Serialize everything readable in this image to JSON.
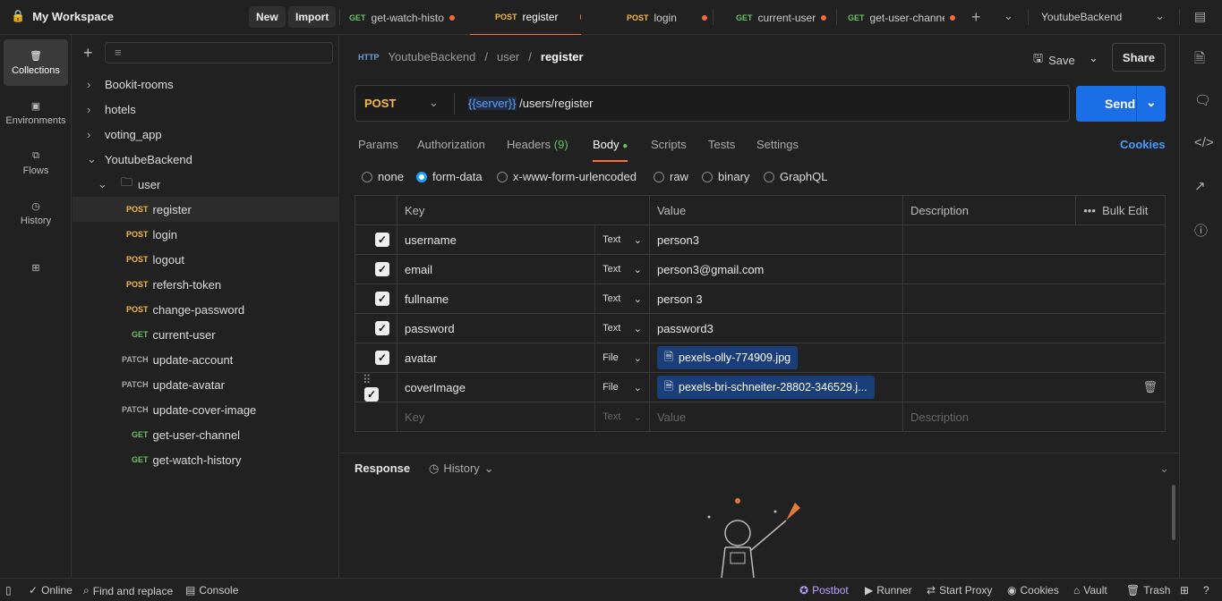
{
  "topbar": {
    "workspace": "My Workspace",
    "new_label": "New",
    "import_label": "Import",
    "tabs": [
      {
        "method": "GET",
        "name": "get-watch-histo"
      },
      {
        "method": "POST",
        "name": "register"
      },
      {
        "method": "POST",
        "name": "login"
      },
      {
        "method": "GET",
        "name": "current-user"
      },
      {
        "method": "GET",
        "name": "get-user-channe"
      }
    ],
    "environment": "YoutubeBackend"
  },
  "leftnav": [
    {
      "label": "Collections",
      "icon": "collections-icon"
    },
    {
      "label": "Environments",
      "icon": "environments-icon"
    },
    {
      "label": "Flows",
      "icon": "flows-icon"
    },
    {
      "label": "History",
      "icon": "history-icon"
    }
  ],
  "sidebar": {
    "collections": [
      "Bookit-rooms",
      "hotels",
      "voting_app",
      "YoutubeBackend"
    ],
    "folder": "user",
    "requests": [
      {
        "method": "POST",
        "name": "register"
      },
      {
        "method": "POST",
        "name": "login"
      },
      {
        "method": "POST",
        "name": "logout"
      },
      {
        "method": "POST",
        "name": "refersh-token"
      },
      {
        "method": "POST",
        "name": "change-password"
      },
      {
        "method": "GET",
        "name": "current-user"
      },
      {
        "method": "PATCH",
        "name": "update-account"
      },
      {
        "method": "PATCH",
        "name": "update-avatar"
      },
      {
        "method": "PATCH",
        "name": "update-cover-image"
      },
      {
        "method": "GET",
        "name": "get-user-channel"
      },
      {
        "method": "GET",
        "name": "get-watch-history"
      }
    ]
  },
  "request": {
    "breadcrumb": [
      "YoutubeBackend",
      "user",
      "register"
    ],
    "save_label": "Save",
    "share_label": "Share",
    "method": "POST",
    "url_var": "{{server}}",
    "url_path": " /users/register",
    "send_label": "Send",
    "tabs": [
      "Params",
      "Authorization",
      "Headers",
      "Body",
      "Scripts",
      "Tests",
      "Settings"
    ],
    "headers_count": "(9)",
    "cookies_label": "Cookies",
    "body_types": [
      "none",
      "form-data",
      "x-www-form-urlencoded",
      "raw",
      "binary",
      "GraphQL"
    ],
    "columns": [
      "Key",
      "Value",
      "Description"
    ],
    "bulk_edit": "Bulk Edit",
    "rows": [
      {
        "key": "username",
        "type": "Text",
        "value": "person3"
      },
      {
        "key": "email",
        "type": "Text",
        "value": "person3@gmail.com"
      },
      {
        "key": "fullname",
        "type": "Text",
        "value": "person 3"
      },
      {
        "key": "password",
        "type": "Text",
        "value": "password3"
      },
      {
        "key": "avatar",
        "type": "File",
        "value": "pexels-olly-774909.jpg"
      },
      {
        "key": "coverImage",
        "type": "File",
        "value": "pexels-bri-schneiter-28802-346529.j..."
      }
    ],
    "placeholder": {
      "key": "Key",
      "type": "Text",
      "value": "Value",
      "description": "Description"
    }
  },
  "response": {
    "label": "Response",
    "history_label": "History"
  },
  "bottombar": {
    "online": "Online",
    "find": "Find and replace",
    "console": "Console",
    "postbot": "Postbot",
    "runner": "Runner",
    "proxy": "Start Proxy",
    "cookies": "Cookies",
    "vault": "Vault",
    "trash": "Trash"
  }
}
